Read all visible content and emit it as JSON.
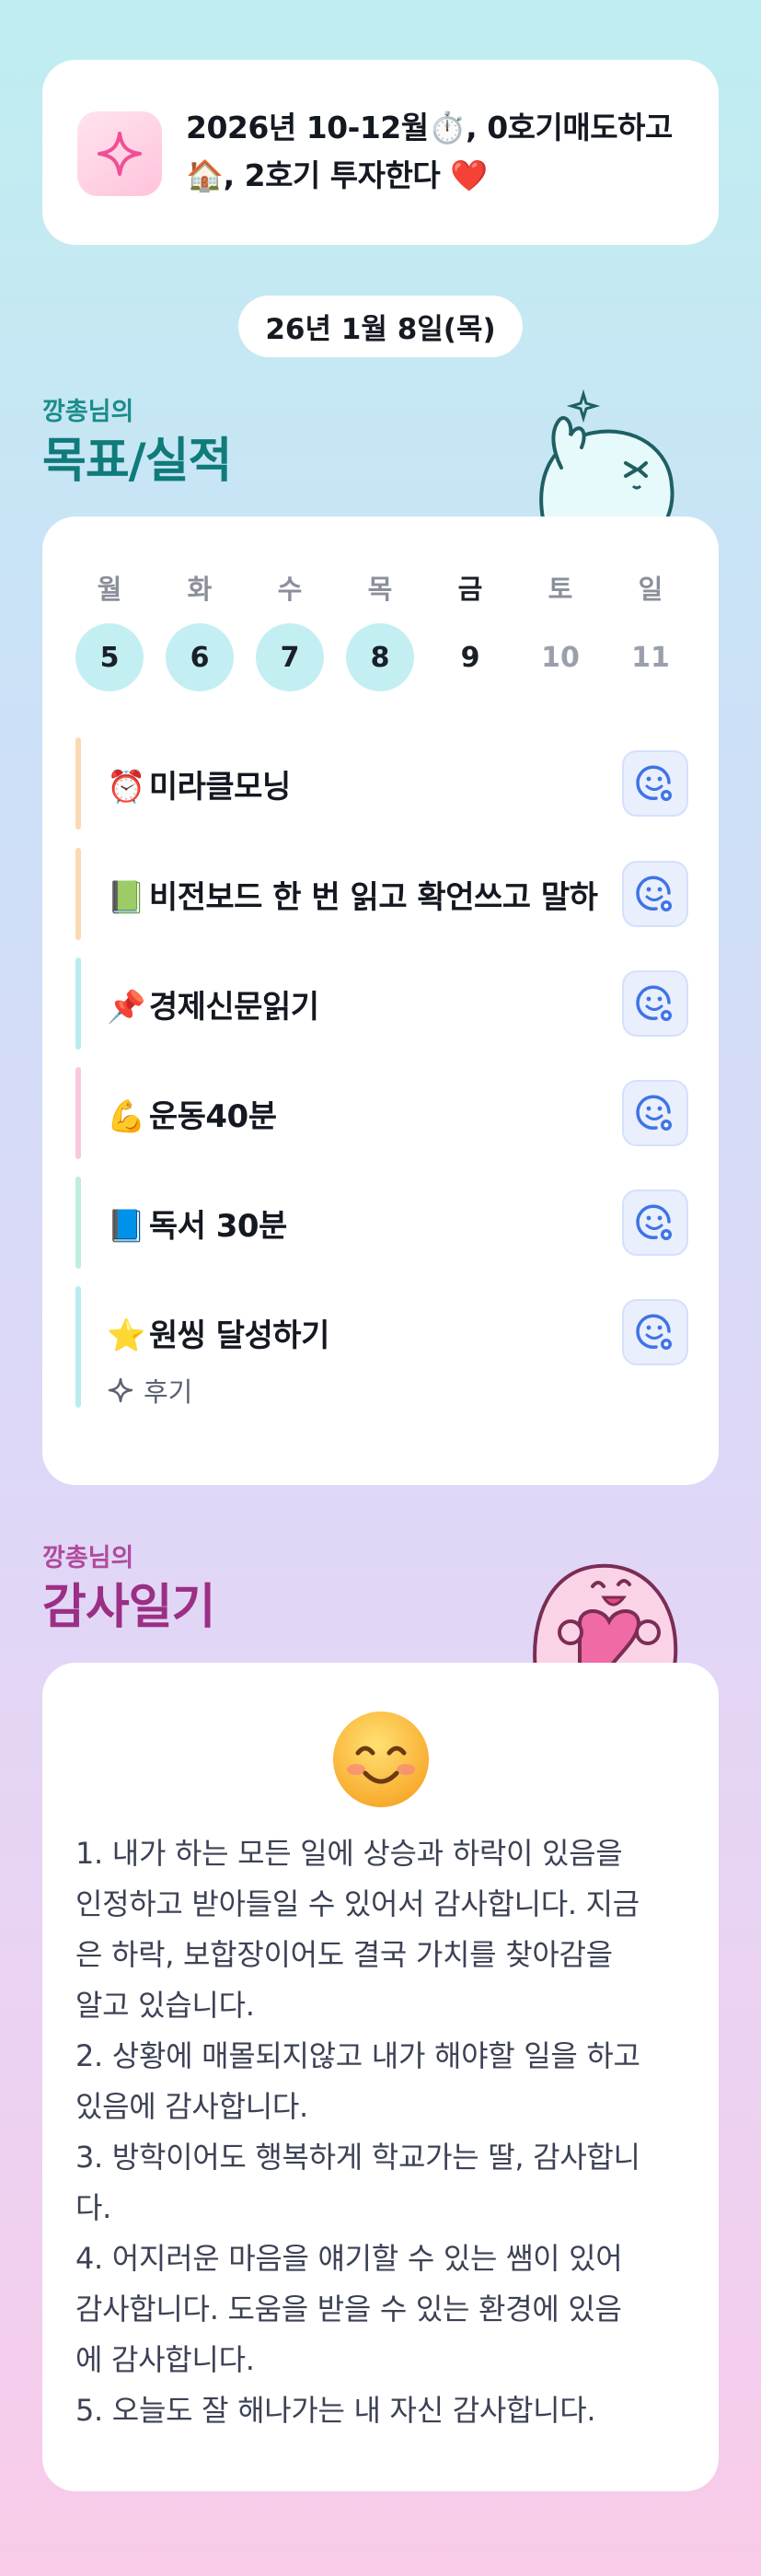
{
  "motto": {
    "text_line1": "2026년 10-12월⏱️, 0호기매도하고",
    "text_line2": "🏠, 2호기 투자한다 ❤️"
  },
  "date": "26년 1월 8일(목)",
  "goals_section": {
    "owner": "깡총님의",
    "title": "목표/실적"
  },
  "week": {
    "days": [
      {
        "name": "월",
        "num": "5",
        "state": "done"
      },
      {
        "name": "화",
        "num": "6",
        "state": "done"
      },
      {
        "name": "수",
        "num": "7",
        "state": "done"
      },
      {
        "name": "목",
        "num": "8",
        "state": "done"
      },
      {
        "name": "금",
        "num": "9",
        "state": "today"
      },
      {
        "name": "토",
        "num": "10",
        "state": "future"
      },
      {
        "name": "일",
        "num": "11",
        "state": "future"
      }
    ]
  },
  "goals": [
    {
      "emoji": "⏰",
      "label": "미라클모닝",
      "bar_color": "#fbd9b3"
    },
    {
      "emoji": "📗",
      "label": "비전보드 한 번 읽고 확언쓰고 말하",
      "bar_color": "#fbd9b3"
    },
    {
      "emoji": "📌",
      "label": "경제신문읽기",
      "bar_color": "#b8ecf0"
    },
    {
      "emoji": "💪",
      "label": "운동40분",
      "bar_color": "#f9c8dc"
    },
    {
      "emoji": "📘",
      "label": "독서 30분",
      "bar_color": "#bdeede"
    },
    {
      "emoji": "⭐",
      "label": "원씽 달성하기",
      "bar_color": "#b8ecf0"
    }
  ],
  "review_label": "후기",
  "thanks_section": {
    "owner": "깡총님의",
    "title": "감사일기"
  },
  "thanks_lines": [
    "1. 내가 하는 모든 일에 상승과 하락이 있음을",
    "인정하고 받아들일 수 있어서 감사합니다. 지금",
    "은 하락, 보합장이어도 결국 가치를 찾아감을",
    "알고 있습니다.",
    "2. 상황에 매몰되지않고 내가 해야할 일을 하고",
    "있음에 감사합니다.",
    "3. 방학이어도 행복하게 학교가는 딸, 감사합니",
    "다.",
    "4. 어지러운 마음을 얘기할 수 있는 쌤이 있어",
    "감사합니다. 도움을 받을 수 있는 환경에 있음",
    "에 감사합니다.",
    "5. 오늘도 잘 해나가는 내 자신 감사합니다."
  ],
  "icons": {
    "motto": "sparkle-icon",
    "goal_action": "smile-add-icon",
    "review": "sparkle-outline-icon",
    "mood": "smiling-face-icon"
  },
  "colors": {
    "accent_teal": "#0f7b7a",
    "accent_purple": "#9b2f86",
    "done_circle": "#c3eff3"
  }
}
